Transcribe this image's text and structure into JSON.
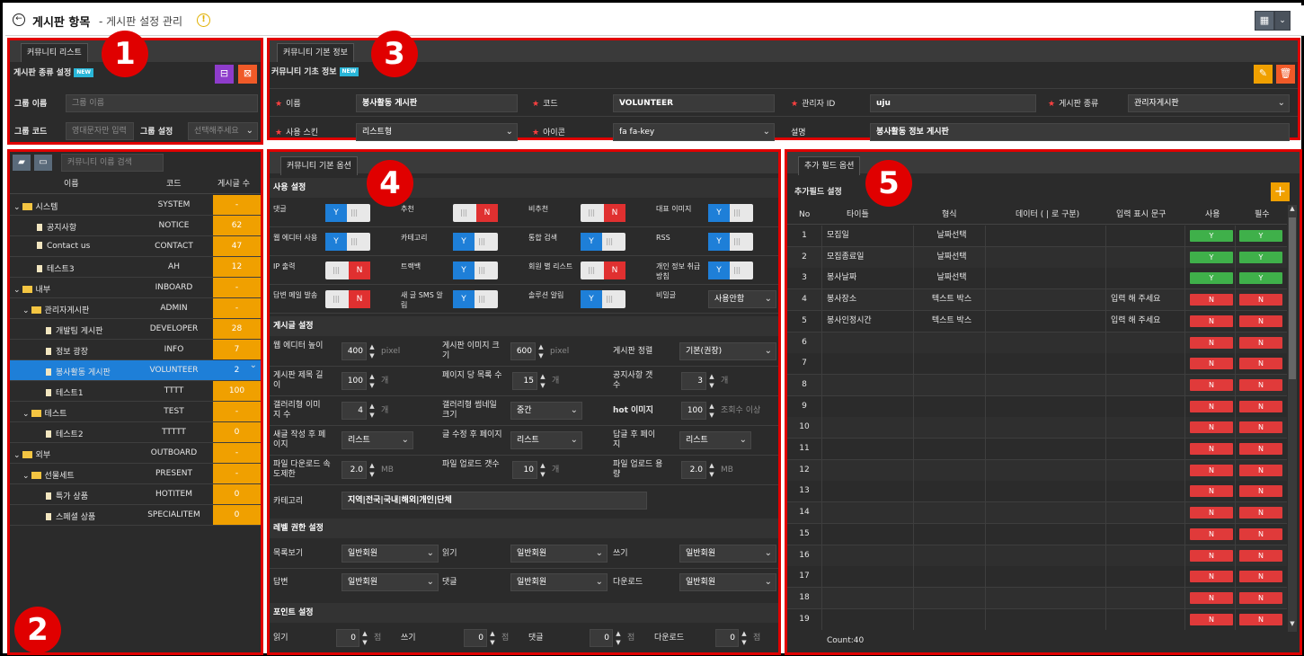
{
  "topbar": {
    "title": "게시판 항목",
    "subtitle": "- 게시판 설정 관리"
  },
  "community_list": {
    "tab": "커뮤니티 리스트",
    "section": "게시판 종류 설정",
    "badge": "NEW",
    "group_name_label": "그룹 이름",
    "group_name_placeholder": "그룹 이름",
    "group_code_label": "그룹 코드",
    "group_code_placeholder": "영대문자만 입력",
    "group_setting_label": "그룹 설정",
    "group_setting_placeholder": "선택해주세요"
  },
  "tree": {
    "search_placeholder": "커뮤니티 이름 검색",
    "columns": [
      "이름",
      "코드",
      "게시글 수"
    ],
    "rows": [
      {
        "name": "시스템",
        "code": "SYSTEM",
        "count": "-",
        "level": 0,
        "type": "folder"
      },
      {
        "name": "공지사항",
        "code": "NOTICE",
        "count": "62",
        "level": 1,
        "type": "doc"
      },
      {
        "name": "Contact us",
        "code": "CONTACT",
        "count": "47",
        "level": 1,
        "type": "doc"
      },
      {
        "name": "테스트3",
        "code": "AH",
        "count": "12",
        "level": 1,
        "type": "doc"
      },
      {
        "name": "내부",
        "code": "INBOARD",
        "count": "-",
        "level": 0,
        "type": "folder"
      },
      {
        "name": "관리자게시판",
        "code": "ADMIN",
        "count": "-",
        "level": 1,
        "type": "folder"
      },
      {
        "name": "개발팀 게시판",
        "code": "DEVELOPER",
        "count": "28",
        "level": 2,
        "type": "doc"
      },
      {
        "name": "정보 광장",
        "code": "INFO",
        "count": "7",
        "level": 2,
        "type": "doc"
      },
      {
        "name": "봉사활동 게시판",
        "code": "VOLUNTEER",
        "count": "2",
        "level": 2,
        "type": "doc",
        "selected": true
      },
      {
        "name": "테스트1",
        "code": "TTTT",
        "count": "100",
        "level": 2,
        "type": "doc"
      },
      {
        "name": "테스트",
        "code": "TEST",
        "count": "-",
        "level": 1,
        "type": "folder"
      },
      {
        "name": "테스트2",
        "code": "TTTTT",
        "count": "0",
        "level": 2,
        "type": "doc"
      },
      {
        "name": "외부",
        "code": "OUTBOARD",
        "count": "-",
        "level": 0,
        "type": "folder"
      },
      {
        "name": "선물세트",
        "code": "PRESENT",
        "count": "-",
        "level": 1,
        "type": "folder"
      },
      {
        "name": "특가 상품",
        "code": "HOTITEM",
        "count": "0",
        "level": 2,
        "type": "doc"
      },
      {
        "name": "스페셜 상품",
        "code": "SPECIALITEM",
        "count": "0",
        "level": 2,
        "type": "doc"
      }
    ]
  },
  "basic_info": {
    "tab": "커뮤니티 기본 정보",
    "section": "커뮤니티 기초 정보",
    "badge": "NEW",
    "name_label": "이름",
    "name_value": "봉사활동 게시판",
    "code_label": "코드",
    "code_value": "VOLUNTEER",
    "admin_label": "관리자 ID",
    "admin_value": "uju",
    "type_label": "게시판 종류",
    "type_value": "관리자게시판",
    "skin_label": "사용 스킨",
    "skin_value": "리스트형",
    "icon_label": "아이콘",
    "icon_value": "fa fa-key",
    "desc_label": "설명",
    "desc_value": "봉사활동 정보 게시판"
  },
  "options": {
    "tab": "커뮤니티 기본 옵션",
    "use_settings": "사용 설정",
    "toggles": [
      {
        "label": "댓글",
        "value": "Y"
      },
      {
        "label": "추천",
        "value": "N"
      },
      {
        "label": "비추천",
        "value": "N"
      },
      {
        "label": "대표 이미지",
        "value": "Y"
      },
      {
        "label": "웹 에디터 사용",
        "value": "Y"
      },
      {
        "label": "카테고리",
        "value": "Y"
      },
      {
        "label": "통합 검색",
        "value": "Y"
      },
      {
        "label": "RSS",
        "value": "Y"
      },
      {
        "label": "IP 출력",
        "value": "N"
      },
      {
        "label": "트랙백",
        "value": "Y"
      },
      {
        "label": "회원 별 리스트",
        "value": "N"
      },
      {
        "label": "개인 정보 취급 방침",
        "value": "Y"
      },
      {
        "label": "답변 메일 발송",
        "value": "N"
      },
      {
        "label": "새 글 SMS 알림",
        "value": "Y"
      },
      {
        "label": "솔루션 알림",
        "value": "Y"
      },
      {
        "label": "비밀글",
        "value": "사용안함"
      }
    ],
    "post_settings": "게시글 설정",
    "editor_height_label": "웹 에디터 높이",
    "editor_height": "400",
    "px_unit": "pixel",
    "board_img_label": "게시판 이미지 크기",
    "board_img": "600",
    "sort_label": "게시판 정렬",
    "sort_value": "기본(권장)",
    "title_len_label": "게시판 제목 길이",
    "title_len": "100",
    "unit_ea": "개",
    "per_page_label": "페이지 당 목록 수",
    "per_page": "15",
    "notice_count_label": "공지사항 갯수",
    "notice_count": "3",
    "gallery_img_label": "갤러리형 이미지 수",
    "gallery_img": "4",
    "gallery_thumb_label": "갤러리형 썸네일 크기",
    "gallery_thumb": "중간",
    "hot_label": "hot 이미지",
    "hot_value": "100",
    "hot_unit": "조회수 이상",
    "new_page_label": "새글 작성 후 페이지",
    "new_page": "리스트",
    "edit_page_label": "글 수정 후 페이지",
    "edit_page": "리스트",
    "reply_page_label": "답글 후 페이지",
    "reply_page": "리스트",
    "dl_limit_label": "파일 다운로드 속도제한",
    "dl_limit": "2.0",
    "mb_unit": "MB",
    "ul_count_label": "파일 업로드 갯수",
    "ul_count": "10",
    "ul_size_label": "파일 업로드 용량",
    "ul_size": "2.0",
    "category_label": "카테고리",
    "category_value": "지역|전국|국내|해외|개인|단체",
    "level_settings": "레벨 권한 설정",
    "list_view_label": "목록보기",
    "list_view": "일반회원",
    "read_label": "읽기",
    "read_value": "일반회원",
    "write_label": "쓰기",
    "write_value": "일반회원",
    "reply_label": "답변",
    "reply_value": "일반회원",
    "comment_label": "댓글",
    "comment_value": "일반회원",
    "download_label": "다운로드",
    "download_value": "일반회원",
    "point_settings": "포인트 설정",
    "pt_read_label": "읽기",
    "pt_read": "0",
    "pt_write_label": "쓰기",
    "pt_write": "0",
    "pt_comment_label": "댓글",
    "pt_comment": "0",
    "pt_dl_label": "다운로드",
    "pt_dl": "0",
    "pt_unit": "점"
  },
  "fields": {
    "tab": "추가 필드 옵션",
    "section": "추가필드 설정",
    "columns": [
      "No",
      "타이틀",
      "형식",
      "데이터 ( | 로 구분)",
      "입력 표시 문구",
      "사용",
      "필수"
    ],
    "rows": [
      {
        "no": "1",
        "title": "모집일",
        "type": "날짜선택",
        "hint": "",
        "use": "Y",
        "req": "Y"
      },
      {
        "no": "2",
        "title": "모집종료일",
        "type": "날짜선택",
        "hint": "",
        "use": "Y",
        "req": "Y"
      },
      {
        "no": "3",
        "title": "봉사날짜",
        "type": "날짜선택",
        "hint": "",
        "use": "Y",
        "req": "Y"
      },
      {
        "no": "4",
        "title": "봉사장소",
        "type": "텍스트 박스",
        "hint": "입력 해 주세요",
        "use": "N",
        "req": "N"
      },
      {
        "no": "5",
        "title": "봉사인정시간",
        "type": "텍스트 박스",
        "hint": "입력 해 주세요",
        "use": "N",
        "req": "N"
      },
      {
        "no": "6",
        "title": "",
        "type": "",
        "hint": "",
        "use": "N",
        "req": "N"
      },
      {
        "no": "7",
        "title": "",
        "type": "",
        "hint": "",
        "use": "N",
        "req": "N"
      },
      {
        "no": "8",
        "title": "",
        "type": "",
        "hint": "",
        "use": "N",
        "req": "N"
      },
      {
        "no": "9",
        "title": "",
        "type": "",
        "hint": "",
        "use": "N",
        "req": "N"
      },
      {
        "no": "10",
        "title": "",
        "type": "",
        "hint": "",
        "use": "N",
        "req": "N"
      },
      {
        "no": "11",
        "title": "",
        "type": "",
        "hint": "",
        "use": "N",
        "req": "N"
      },
      {
        "no": "12",
        "title": "",
        "type": "",
        "hint": "",
        "use": "N",
        "req": "N"
      },
      {
        "no": "13",
        "title": "",
        "type": "",
        "hint": "",
        "use": "N",
        "req": "N"
      },
      {
        "no": "14",
        "title": "",
        "type": "",
        "hint": "",
        "use": "N",
        "req": "N"
      },
      {
        "no": "15",
        "title": "",
        "type": "",
        "hint": "",
        "use": "N",
        "req": "N"
      },
      {
        "no": "16",
        "title": "",
        "type": "",
        "hint": "",
        "use": "N",
        "req": "N"
      },
      {
        "no": "17",
        "title": "",
        "type": "",
        "hint": "",
        "use": "N",
        "req": "N"
      },
      {
        "no": "18",
        "title": "",
        "type": "",
        "hint": "",
        "use": "N",
        "req": "N"
      },
      {
        "no": "19",
        "title": "",
        "type": "",
        "hint": "",
        "use": "N",
        "req": "N"
      }
    ],
    "count": "Count:40"
  },
  "markers": [
    "1",
    "2",
    "3",
    "4",
    "5"
  ],
  "colors": {
    "accent": "#1e7fd8",
    "highlight": "#e00000",
    "count_bg": "#f0a000",
    "yes": "#3fb04a",
    "no": "#e03a3a"
  }
}
